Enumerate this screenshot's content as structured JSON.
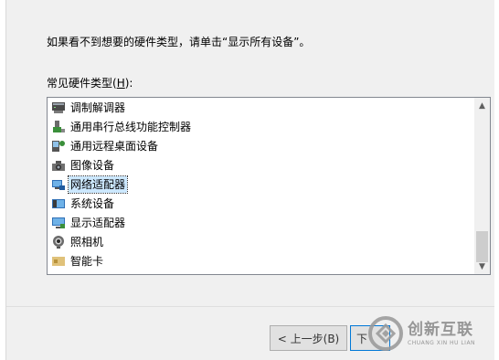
{
  "dialog": {
    "instruction": "如果看不到想要的硬件类型，请单击“显示所有设备”。",
    "list_caption_prefix": "常见硬件类型(",
    "list_caption_hotkey": "H",
    "list_caption_suffix": "):"
  },
  "hardware_list": {
    "items": [
      {
        "label": "调制解调器",
        "icon": "modem-icon",
        "selected": false
      },
      {
        "label": "通用串行总线功能控制器",
        "icon": "usb-controller-icon",
        "selected": false
      },
      {
        "label": "通用远程桌面设备",
        "icon": "remote-desktop-icon",
        "selected": false
      },
      {
        "label": "图像设备",
        "icon": "camera-device-icon",
        "selected": false
      },
      {
        "label": "网络适配器",
        "icon": "network-adapter-icon",
        "selected": true
      },
      {
        "label": "系统设备",
        "icon": "system-device-icon",
        "selected": false
      },
      {
        "label": "显示适配器",
        "icon": "display-adapter-icon",
        "selected": false
      },
      {
        "label": "照相机",
        "icon": "webcam-icon",
        "selected": false
      },
      {
        "label": "智能卡",
        "icon": "smart-card-icon",
        "selected": false
      }
    ],
    "selection_color": "#cce8ff"
  },
  "buttons": {
    "back_label": "< 上一步(B)",
    "next_label": "下"
  },
  "watermark": {
    "name_cn": "创新互联",
    "name_en": "CHUANG XIN HU LIAN"
  }
}
